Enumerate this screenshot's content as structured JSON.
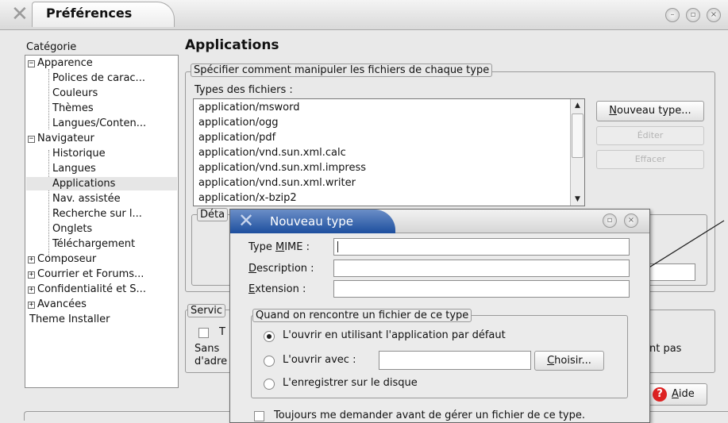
{
  "window": {
    "title": "Préférences",
    "controls": [
      "minimize-icon",
      "maximize-icon",
      "close-icon"
    ]
  },
  "sidebar": {
    "label": "Catégorie",
    "items": [
      {
        "label": "Apparence",
        "expander": "⊟",
        "level": 0
      },
      {
        "label": "Polices de carac...",
        "level": 1
      },
      {
        "label": "Couleurs",
        "level": 1
      },
      {
        "label": "Thèmes",
        "level": 1
      },
      {
        "label": "Langues/Conten...",
        "level": 1
      },
      {
        "label": "Navigateur",
        "expander": "⊟",
        "level": 0
      },
      {
        "label": "Historique",
        "level": 1
      },
      {
        "label": "Langues",
        "level": 1
      },
      {
        "label": "Applications",
        "level": 1,
        "selected": true
      },
      {
        "label": "Nav. assistée",
        "level": 1
      },
      {
        "label": "Recherche sur l...",
        "level": 1
      },
      {
        "label": "Onglets",
        "level": 1
      },
      {
        "label": "Téléchargement",
        "level": 1
      },
      {
        "label": "Composeur",
        "expander": "⊞",
        "level": 0
      },
      {
        "label": "Courrier et Forums...",
        "expander": "⊞",
        "level": 0
      },
      {
        "label": "Confidentialité et S...",
        "expander": "⊞",
        "level": 0
      },
      {
        "label": "Avancées",
        "expander": "⊞",
        "level": 0
      },
      {
        "label": "Theme Installer",
        "level": 0
      }
    ]
  },
  "main": {
    "title": "Applications",
    "group_title": "Spécifier comment manipuler les fichiers de chaque type",
    "file_types_label": "Types des fichiers :",
    "file_types": [
      "application/msword",
      "application/ogg",
      "application/pdf",
      "application/vnd.sun.xml.calc",
      "application/vnd.sun.xml.impress",
      "application/vnd.sun.xml.writer",
      "application/x-bzip2"
    ],
    "new_type_button": {
      "underline": "N",
      "rest": "ouveau type..."
    },
    "edit_button": "Éditer",
    "remove_button": "Effacer",
    "details_group_partial": "Déta",
    "services_group_partial": "Servic",
    "services_checkbox_partial": "T",
    "services_text_line1": "Sans",
    "services_text_line2": "d'adre",
    "services_right_text": "nt pas",
    "help_button": {
      "underline": "A",
      "rest": "ide"
    }
  },
  "dialog": {
    "title": "Nouveau type",
    "controls": [
      "maximize-icon",
      "close-icon"
    ],
    "mime_label": {
      "before": "Type ",
      "underline": "M",
      "after": "IME :"
    },
    "mime_value": "",
    "description_label": {
      "before": "",
      "underline": "D",
      "after": "escription :"
    },
    "description_value": "",
    "extension_label": {
      "before": "",
      "underline": "E",
      "after": "xtension :"
    },
    "extension_value": "",
    "group_title": "Quand on rencontre un fichier de ce type",
    "options": [
      {
        "label": "L'ouvrir en utilisant l'application par défaut",
        "selected": true
      },
      {
        "label": "L'ouvrir avec :",
        "selected": false
      },
      {
        "label": "L'enregistrer sur le disque",
        "selected": false
      }
    ],
    "open_with_value": "",
    "choose_button": {
      "underline": "C",
      "rest": "hoisir..."
    },
    "always_ask_label": "Toujours me demander avant de gérer un fichier de ce type.",
    "always_ask_checked": false
  },
  "colors": {
    "dialog_title_tab": "#1d4f9e",
    "selected_row": "#e6e6e6",
    "help_icon": "#d22222"
  }
}
